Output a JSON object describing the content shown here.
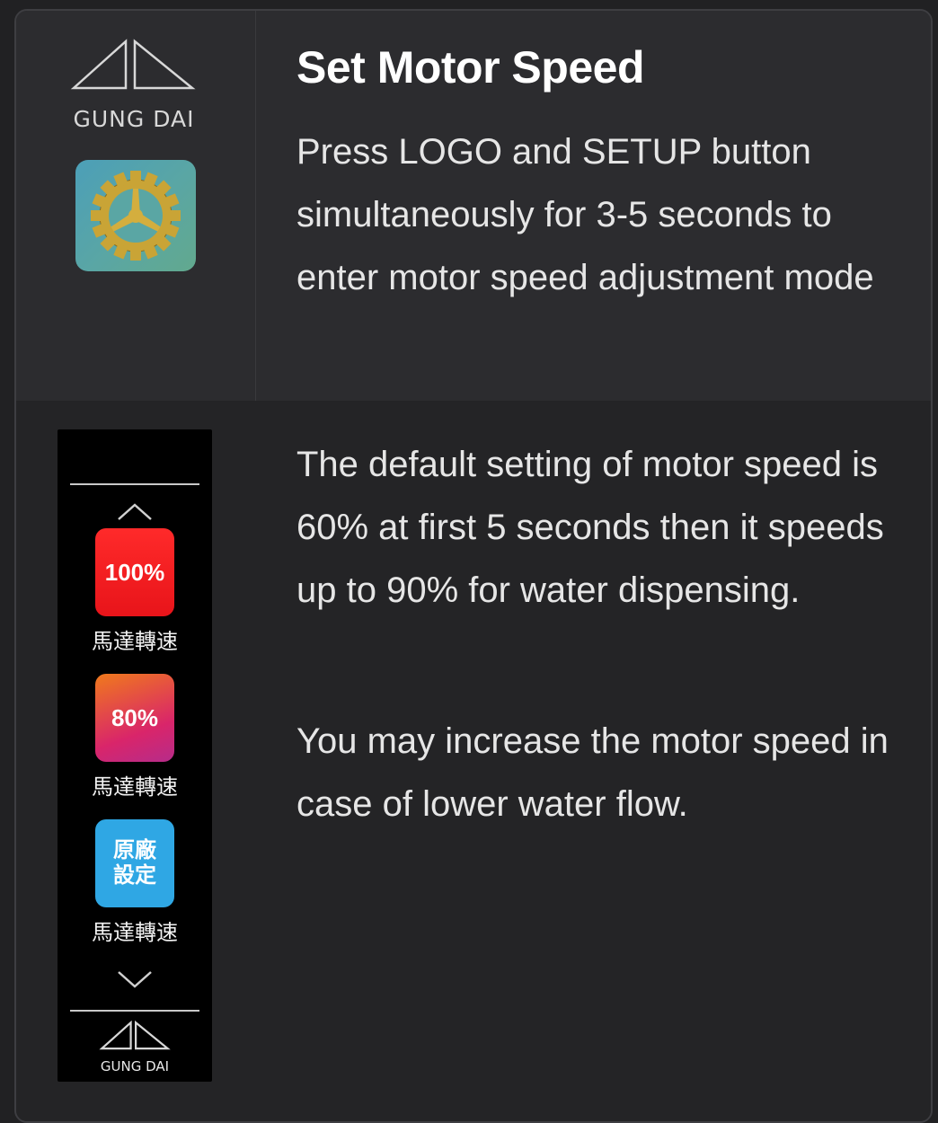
{
  "brand": {
    "name": "GUNG DAI"
  },
  "section": {
    "title": "Set Motor Speed",
    "instruction": "Press LOGO and SETUP button simultaneously for 3-5 seconds to enter motor speed adjustment mode"
  },
  "details": {
    "paragraph1": "The default setting of motor speed is 60% at first 5 seconds then it speeds up to 90% for water dispensing.",
    "paragraph2": "You may increase the motor speed in case of lower water flow."
  },
  "panel": {
    "options": [
      {
        "value": "100%",
        "label": "馬達轉速",
        "color": "#e8141a"
      },
      {
        "value": "80%",
        "label": "馬達轉速",
        "color": "#d9256a"
      },
      {
        "value_line1": "原廠",
        "value_line2": "設定",
        "label": "馬達轉速",
        "color": "#2fa7e4"
      }
    ],
    "footer_brand": "GUNG DAI"
  },
  "icons": {
    "up": "chevron-up-icon",
    "down": "chevron-down-icon",
    "settings": "gear-icon",
    "logo": "gung-dai-logo-icon"
  }
}
